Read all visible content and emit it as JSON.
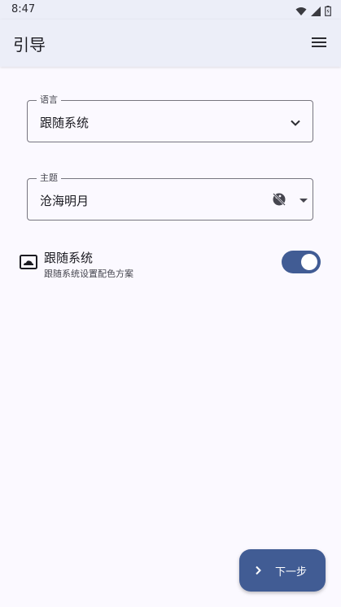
{
  "status_bar": {
    "time": "8:47",
    "icons": [
      "wifi-icon",
      "signal-icon",
      "battery-icon"
    ]
  },
  "app_bar": {
    "title": "引导",
    "menu_icon": "menu-icon"
  },
  "language_field": {
    "label": "语言",
    "value": "跟随系统",
    "icon": "chevron-down-icon"
  },
  "theme_field": {
    "label": "主题",
    "value": "沧海明月",
    "icon": "palette-off-icon"
  },
  "follow_system": {
    "title": "跟随系统",
    "subtitle": "跟随系统设置配色方案",
    "icon": "cloud-display-icon",
    "enabled": true
  },
  "fab": {
    "label": "下一步",
    "icon": "chevron-right-icon"
  },
  "colors": {
    "background": "#fbf9ff",
    "app_bar": "#eceef8",
    "accent": "#415c94"
  }
}
